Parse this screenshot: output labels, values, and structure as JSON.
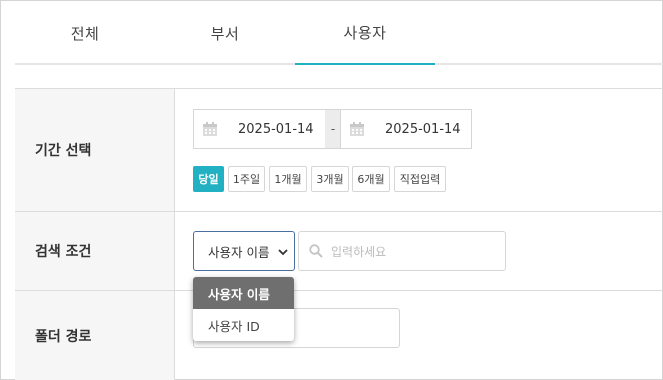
{
  "tabs": [
    {
      "label": "전체"
    },
    {
      "label": "부서"
    },
    {
      "label": "사용자"
    }
  ],
  "active_tab": "사용자",
  "accent_color": "#22b0c3",
  "period": {
    "label": "기간 선택",
    "start_date": "2025-01-14",
    "separator": "-",
    "end_date": "2025-01-14",
    "quick_options": [
      "당일",
      "1주일",
      "1개월",
      "3개월",
      "6개월",
      "직접입력"
    ],
    "selected_quick": "당일",
    "calendar_icon": "calendar-icon"
  },
  "search": {
    "label": "검색 조건",
    "selected_option": "사용자 이름",
    "placeholder": "입력하세요",
    "options": [
      "사용자 이름",
      "사용자 ID"
    ],
    "search_icon": "search-icon"
  },
  "folder": {
    "label": "폴더 경로",
    "value": ""
  }
}
